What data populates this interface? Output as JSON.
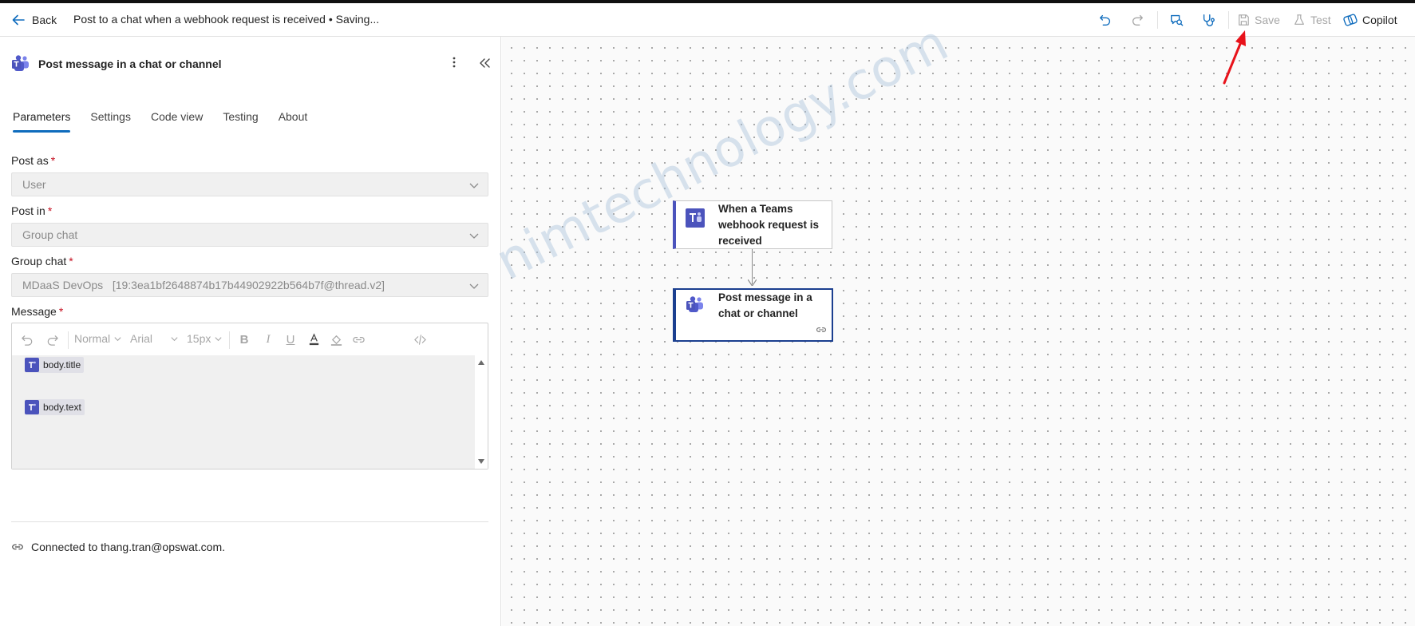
{
  "topbar": {
    "back_label": "Back",
    "flow_title": "Post to a chat when a webhook request is received • Saving...",
    "save_label": "Save",
    "test_label": "Test",
    "copilot_label": "Copilot",
    "icons": [
      "undo-icon",
      "redo-icon",
      "flow-checker-icon",
      "stethoscope-icon",
      "save-icon",
      "flask-icon",
      "copilot-icon"
    ]
  },
  "panel": {
    "title": "Post message in a chat or channel",
    "tabs": [
      {
        "label": "Parameters",
        "active": true
      },
      {
        "label": "Settings",
        "active": false
      },
      {
        "label": "Code view",
        "active": false
      },
      {
        "label": "Testing",
        "active": false
      },
      {
        "label": "About",
        "active": false
      }
    ],
    "fields": {
      "post_as": {
        "label": "Post as",
        "required_mark": "*",
        "value": "User"
      },
      "post_in": {
        "label": "Post in",
        "required_mark": "*",
        "value": "Group chat"
      },
      "group_chat": {
        "label": "Group chat",
        "required_mark": "*",
        "value": "MDaaS DevOps   [19:3ea1bf2648874b17b44902922b564b7f@thread.v2]"
      },
      "message": {
        "label": "Message",
        "required_mark": "*",
        "toolbar": {
          "style": "Normal",
          "font": "Arial",
          "size": "15px"
        },
        "tokens": [
          "body.title",
          "body.text"
        ]
      }
    },
    "connection": "Connected to thang.tran@opswat.com."
  },
  "canvas": {
    "trigger_card": "When a Teams webhook request is received",
    "action_card": "Post message in a chat or channel",
    "watermark": "nimtechnology.com"
  },
  "colors": {
    "accent": "#0f6cbd",
    "teams": "#4b53bc",
    "required": "#c50f1f",
    "selected_border": "#1b3f8f",
    "annotation_arrow": "#e8121a"
  }
}
